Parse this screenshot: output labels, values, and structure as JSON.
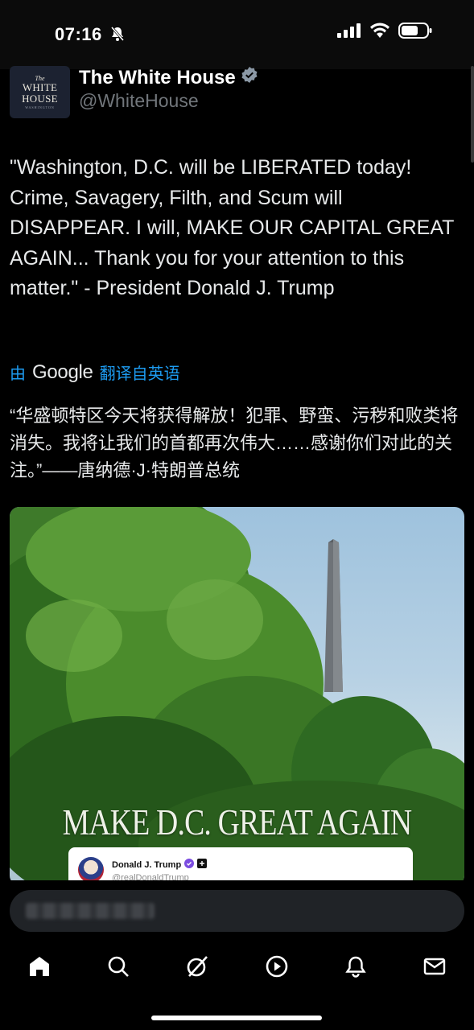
{
  "status_bar": {
    "time": "07:16",
    "icons": [
      "bell-slash-icon",
      "signal-icon",
      "wifi-icon",
      "battery-icon"
    ]
  },
  "author": {
    "logo_text": {
      "the": "The",
      "line1": "WHITE",
      "line2": "HOUSE",
      "sub": "WASHINGTON"
    },
    "display_name": "The White House",
    "verified_icon": "verified-badge-icon",
    "handle": "@WhiteHouse"
  },
  "tweet": {
    "text": "\"Washington, D.C. will be LIBERATED today! Crime, Savagery, Filth, and Scum will DISAPPEAR. I will, MAKE OUR CAPITAL GREAT AGAIN... Thank you for your attention to this matter.\" - President Donald J. Trump",
    "translate_prefix": "由",
    "translate_brand": "Google",
    "translate_suffix": "翻译自英语",
    "translated_text": "“华盛顿特区今天将获得解放！犯罪、野蛮、污秽和败类将消失。我将让我们的首都再次伟大……感谢你们对此的关注。”——唐纳德·J·特朗普总统"
  },
  "media": {
    "overlay_text": "MAKE D.C. GREAT AGAIN",
    "embedded": {
      "name": "Donald J. Trump",
      "handle": "@realDonaldTrump"
    }
  },
  "tab_bar": {
    "items": [
      "home-icon",
      "search-icon",
      "grok-icon",
      "video-icon",
      "notifications-icon",
      "messages-icon"
    ]
  },
  "colors": {
    "accent": "#1d9bf0",
    "background": "#000000",
    "text": "#e7e9ea",
    "secondary": "#71767b"
  }
}
